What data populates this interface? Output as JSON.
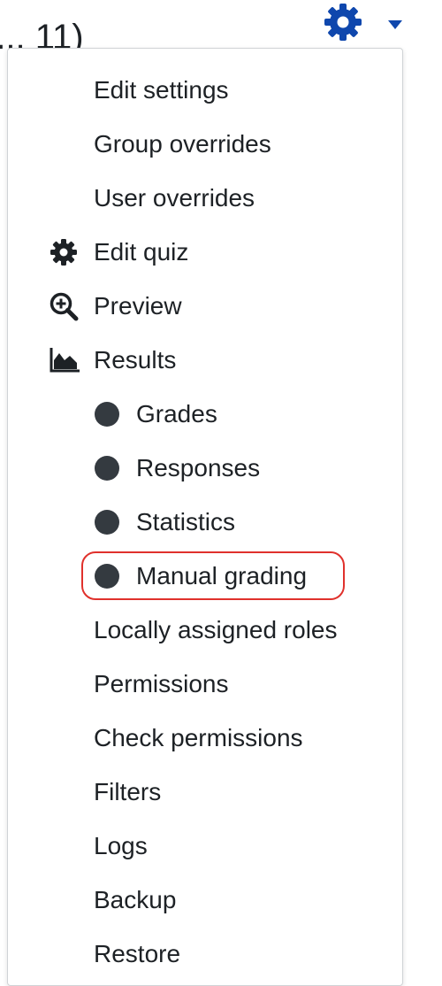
{
  "background": {
    "title_fragment": "(... 11)"
  },
  "toggle": {
    "icon": "gear-icon",
    "caret": "caret-down-icon",
    "color": "#0f47ad"
  },
  "menu": {
    "items": [
      {
        "label": "Edit settings",
        "icon": null,
        "indent": 0
      },
      {
        "label": "Group overrides",
        "icon": null,
        "indent": 0
      },
      {
        "label": "User overrides",
        "icon": null,
        "indent": 0
      },
      {
        "label": "Edit quiz",
        "icon": "gear-icon",
        "indent": 0
      },
      {
        "label": "Preview",
        "icon": "zoom-in-icon",
        "indent": 0
      },
      {
        "label": "Results",
        "icon": "area-chart-icon",
        "indent": 0
      },
      {
        "label": "Grades",
        "icon": "bullet-icon",
        "indent": 1
      },
      {
        "label": "Responses",
        "icon": "bullet-icon",
        "indent": 1
      },
      {
        "label": "Statistics",
        "icon": "bullet-icon",
        "indent": 1
      },
      {
        "label": "Manual grading",
        "icon": "bullet-icon",
        "indent": 1,
        "highlighted": true
      },
      {
        "label": "Locally assigned roles",
        "icon": null,
        "indent": 0
      },
      {
        "label": "Permissions",
        "icon": null,
        "indent": 0
      },
      {
        "label": "Check permissions",
        "icon": null,
        "indent": 0
      },
      {
        "label": "Filters",
        "icon": null,
        "indent": 0
      },
      {
        "label": "Logs",
        "icon": null,
        "indent": 0
      },
      {
        "label": "Backup",
        "icon": null,
        "indent": 0
      },
      {
        "label": "Restore",
        "icon": null,
        "indent": 0
      }
    ],
    "highlight_color": "#e0312c"
  }
}
